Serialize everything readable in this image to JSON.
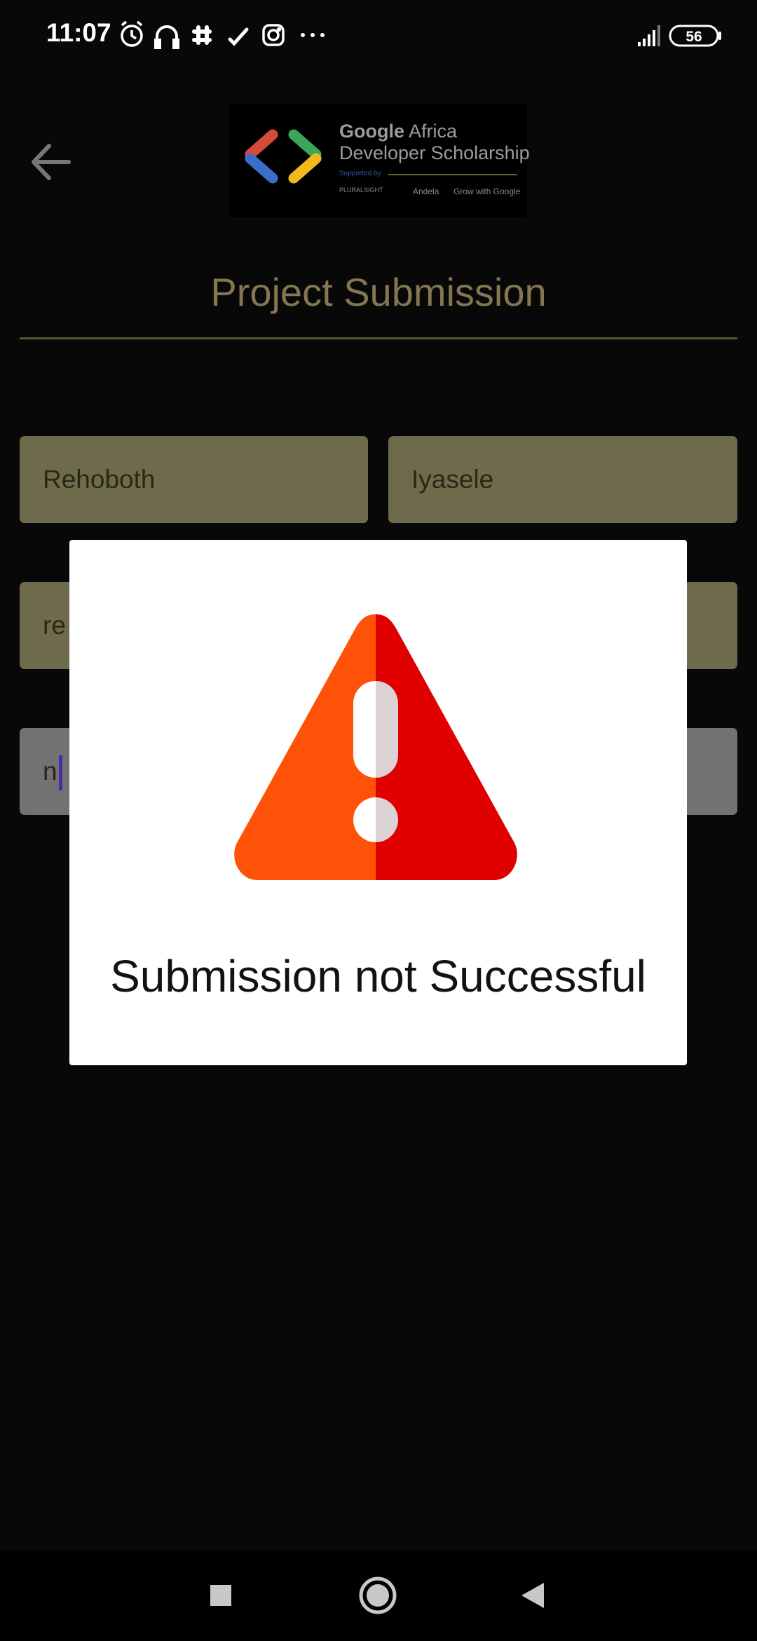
{
  "status_bar": {
    "time": "11:07",
    "battery": "56",
    "icons": [
      "alarm-icon",
      "headphones-icon",
      "slack-icon",
      "check-icon",
      "instagram-icon",
      "more-icon",
      "signal-icon",
      "battery-icon"
    ]
  },
  "header": {
    "back_icon": "arrow-left-icon",
    "banner": {
      "line1_bold": "Google",
      "line1_rest": " Africa",
      "line2": "Developer Scholarship",
      "supported": "Supported by",
      "sponsor1": "PLURALSIGHT",
      "sponsor2": "Andela",
      "sponsor3": "Grow with Google"
    }
  },
  "page_title": "Project Submission",
  "form": {
    "first_name": "Rehoboth",
    "last_name": "Iyasele",
    "email_partial": "re",
    "link_partial": "n"
  },
  "dialog": {
    "icon": "warning-triangle-icon",
    "message": "Submission not Successful"
  },
  "nav_bar": {
    "recents_icon": "square-icon",
    "home_icon": "circle-icon",
    "back_icon": "triangle-back-icon"
  },
  "colors": {
    "background": "#080808",
    "title": "#837650",
    "field": "#6e6b4c",
    "warning_left": "#ff5209",
    "warning_right": "#e00000"
  }
}
